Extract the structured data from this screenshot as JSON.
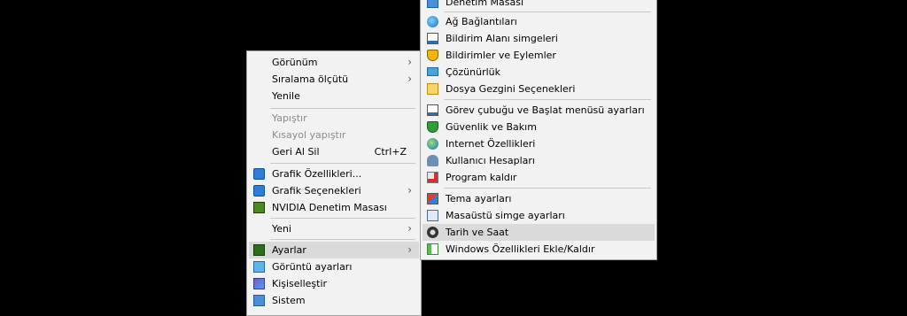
{
  "context_menu": {
    "items": [
      {
        "label": "Görünüm"
      },
      {
        "label": "Sıralama ölçütü"
      },
      {
        "label": "Yenile"
      },
      {
        "label": "Yapıştır"
      },
      {
        "label": "Kısayol yapıştır"
      },
      {
        "label": "Geri Al Sil",
        "shortcut": "Ctrl+Z"
      },
      {
        "label": "Grafik Özellikleri..."
      },
      {
        "label": "Grafik Seçenekleri"
      },
      {
        "label": "NVIDIA Denetim Masası"
      },
      {
        "label": "Yeni"
      },
      {
        "label": "Ayarlar"
      },
      {
        "label": "Görüntü ayarları"
      },
      {
        "label": "Kişiselleştir"
      },
      {
        "label": "Sistem"
      }
    ]
  },
  "submenu": {
    "items": [
      {
        "label": "Denetim Masası"
      },
      {
        "label": "Ağ Bağlantıları"
      },
      {
        "label": "Bildirim Alanı simgeleri"
      },
      {
        "label": "Bildirimler ve Eylemler"
      },
      {
        "label": "Çözünürlük"
      },
      {
        "label": "Dosya Gezgini Seçenekleri"
      },
      {
        "label": "Görev çubuğu ve Başlat menüsü ayarları"
      },
      {
        "label": "Güvenlik ve Bakım"
      },
      {
        "label": "Internet Özellikleri"
      },
      {
        "label": "Kullanıcı Hesapları"
      },
      {
        "label": "Program kaldır"
      },
      {
        "label": "Tema ayarları"
      },
      {
        "label": "Masaüstü simge ayarları"
      },
      {
        "label": "Tarih ve Saat"
      },
      {
        "label": "Windows Özellikleri Ekle/Kaldır"
      }
    ]
  },
  "icons": {
    "submenu_arrow": "›"
  },
  "colors": {
    "menu_bg": "#f2f2f2",
    "highlight": "#dadada",
    "disabled_text": "#8a8a8a"
  }
}
